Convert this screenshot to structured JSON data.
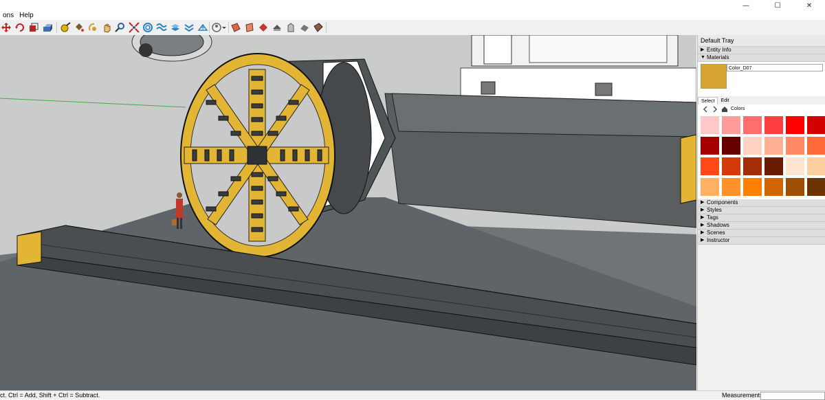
{
  "window": {
    "close_glyph": "✕"
  },
  "menu": {
    "items": [
      "ons",
      "Help"
    ]
  },
  "toolbar": {
    "icons": [
      "move-tool-icon",
      "rotate-tool-icon",
      "scale-tool-icon",
      "pushpull-tool-icon",
      "paint-bucket-icon",
      "orbit-icon",
      "pan-icon",
      "zoom-icon",
      "zoom-extents-icon",
      "sandbox-from-contours-icon",
      "sandbox-smoove-icon",
      "sandbox-stamp-icon",
      "sandbox-drape-icon",
      "sandbox-add-detail-icon",
      "geo-location-icon",
      "section-plane-icon",
      "display-section-planes-icon",
      "display-section-cuts-icon",
      "section-fill-icon",
      "materials-sample-icon",
      "style-sample-icon"
    ]
  },
  "tray": {
    "title": "Default Tray",
    "panels_top": [
      "Entity Info",
      "Materials"
    ],
    "material_name": "Color_D07",
    "material_color": "#D9A532",
    "tabs": [
      "Select",
      "Edit"
    ],
    "collection": "Colors",
    "swatches": [
      "#FFC9C9",
      "#FF9C9C",
      "#FF6E6E",
      "#FF3F3F",
      "#FF0000",
      "#D40000",
      "#A50000",
      "#660000",
      "#FFD2C4",
      "#FFAF93",
      "#FF8A63",
      "#FF6A3A",
      "#FF4A17",
      "#D43A0A",
      "#A52D06",
      "#6A1C00",
      "#FFE5D0",
      "#FFCFA0",
      "#FFB061",
      "#FF9228",
      "#FF7F00",
      "#D16600",
      "#9E4E00",
      "#6B3400"
    ],
    "panels_bottom": [
      "Components",
      "Styles",
      "Tags",
      "Shadows",
      "Scenes",
      "Instructor"
    ]
  },
  "status": {
    "text": "ct. Ctrl = Add, Shift + Ctrl = Subtract.",
    "measurements_label": "Measurements"
  }
}
